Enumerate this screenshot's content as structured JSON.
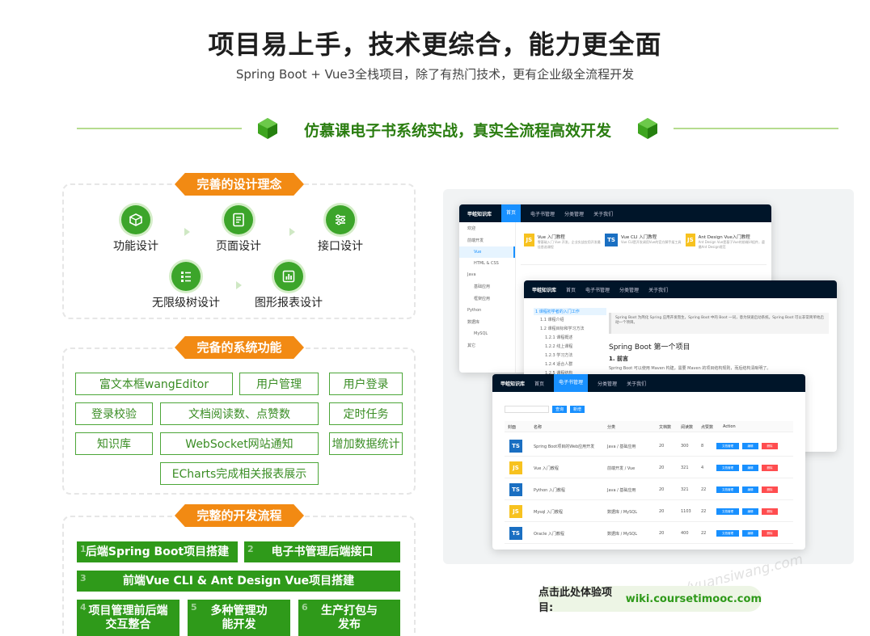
{
  "header": {
    "title": "项目易上手，技术更综合，能力更全面",
    "subtitle": "Spring Boot + Vue3全栈项目，除了有热门技术，更有企业级全流程开发"
  },
  "section": {
    "title": "仿慕课电子书系统实战，真实全流程高效开发"
  },
  "design": {
    "ribbon": "完善的设计理念",
    "items": [
      {
        "label": "功能设计",
        "icon": "cube-icon"
      },
      {
        "label": "页面设计",
        "icon": "document-icon"
      },
      {
        "label": "接口设计",
        "icon": "sliders-icon"
      },
      {
        "label": "无限级树设计",
        "icon": "list-tree-icon"
      },
      {
        "label": "图形报表设计",
        "icon": "bar-chart-icon"
      }
    ]
  },
  "functions": {
    "ribbon": "完备的系统功能",
    "items": [
      "富文本框wangEditor",
      "用户管理",
      "用户登录",
      "登录校验",
      "文档阅读数、点赞数",
      "定时任务",
      "知识库",
      "WebSocket网站通知",
      "增加数据统计",
      "ECharts完成相关报表展示"
    ]
  },
  "process": {
    "ribbon": "完整的开发流程",
    "steps": [
      {
        "num": "1",
        "label": "后端Spring Boot项目搭建"
      },
      {
        "num": "2",
        "label": "电子书管理后端接口"
      },
      {
        "num": "3",
        "label": "前端Vue CLI & Ant Design Vue项目搭建"
      },
      {
        "num": "4",
        "label": "项目管理前后端交互整合"
      },
      {
        "num": "5",
        "label": "多种管理功能开发"
      },
      {
        "num": "6",
        "label": "生产打包与发布"
      }
    ]
  },
  "preview": {
    "win1": {
      "logo": "甲蛙知识库",
      "tabs": [
        "首页",
        "电子书管理",
        "分类管理",
        "关于我们"
      ],
      "sidebar": [
        "欢迎",
        "前端开发",
        "Vue",
        "HTML & CSS",
        "Java",
        "基础应用",
        "框架应用",
        "Python",
        "数据库",
        "MySQL",
        "其它"
      ],
      "cards": [
        {
          "badge": "JS",
          "title": "Vue 入门教程",
          "desc": "零基础入门 Vue 开发，企业实战应用开发最佳首选课程"
        },
        {
          "badge": "TS",
          "title": "Vue CLI 入门教程",
          "desc": "Vue CLI是开发调用Vue的官方脚手架工具"
        },
        {
          "badge": "JS",
          "title": "Ant Design Vue入门教程",
          "desc": "Ant Design Vue是基于Vue的前端UI组件，遵循Ant Design规范"
        }
      ]
    },
    "win2": {
      "logo": "甲蛙知识库",
      "tabs": [
        "首页",
        "电子书管理",
        "分类管理",
        "关于我们"
      ],
      "tree": [
        "1 课程初学者的入门工作",
        "1.1 课程介绍",
        "1.2 课程目标和学习方法",
        "1.2.1 课程概述",
        "1.2.2 线上课程",
        "1.2.3 学习方法",
        "1.2.4 适合人群",
        "1.2.5 课程结构"
      ],
      "notice": "Spring Boot 为简化 Spring 应用开发而生，Spring Boot 中的 Boot 一词，意为快速启动系统。Spring Boot 可以非常简单地启动一个项目。",
      "heading": "Spring Boot 第一个项目",
      "subheading": "1. 前言",
      "body": "Spring Boot 可以使用 Maven 构建，需要 Maven 的项目结构规则，而后结构清晰明了。"
    },
    "win3": {
      "logo": "甲蛙知识库",
      "tabs": [
        "首页",
        "电子书管理",
        "分类管理",
        "关于我们"
      ],
      "buttons": [
        "查询",
        "新增"
      ],
      "columns": [
        "封面",
        "名称",
        "分类",
        "文档数",
        "阅读数",
        "点赞数",
        "Action"
      ],
      "rows": [
        {
          "badge": "TS",
          "name": "Spring Boot项目的Web应用开发",
          "category": "Java / 基础应用",
          "docs": "20",
          "views": "300",
          "likes": "8"
        },
        {
          "badge": "JS",
          "name": "Vue 入门教程",
          "category": "前端开发 / Vue",
          "docs": "20",
          "views": "321",
          "likes": "4"
        },
        {
          "badge": "TS",
          "name": "Python 入门教程",
          "category": "Java / 基础应用",
          "docs": "20",
          "views": "321",
          "likes": "22"
        },
        {
          "badge": "JS",
          "name": "Mysql 入门教程",
          "category": "数据库 / MySQL",
          "docs": "20",
          "views": "1103",
          "likes": "22"
        },
        {
          "badge": "TS",
          "name": "Oracle 入门教程",
          "category": "数据库 / MySQL",
          "docs": "20",
          "views": "400",
          "likes": "22"
        }
      ],
      "actions": [
        "文档管理",
        "编辑",
        "删除"
      ]
    }
  },
  "cta": {
    "label": "点击此处体验项目:",
    "link": "wiki.coursetimooc.com"
  },
  "watermark": "/yuansiwang.com",
  "colors": {
    "green": "#2f9a1a",
    "orange": "#f28a13",
    "navy": "#001529",
    "blue": "#1890ff",
    "red": "#ff4d4f"
  }
}
